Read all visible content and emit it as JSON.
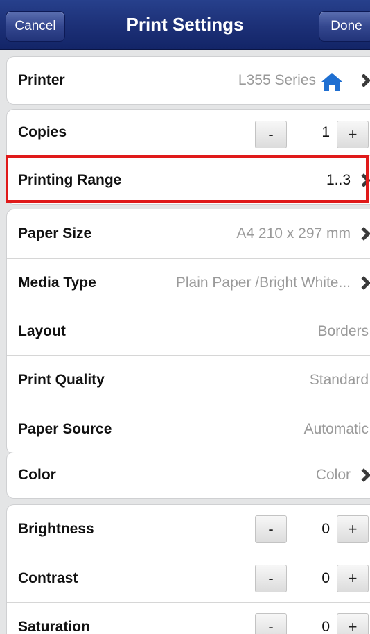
{
  "header": {
    "title": "Print Settings",
    "cancel_label": "Cancel",
    "done_label": "Done"
  },
  "printer": {
    "label": "Printer",
    "value": "L355 Series"
  },
  "copies": {
    "label": "Copies",
    "value": "1",
    "minus": "-",
    "plus": "+"
  },
  "range": {
    "label": "Printing Range",
    "value": "1..3"
  },
  "paper_size": {
    "label": "Paper Size",
    "value": "A4 210 x 297 mm"
  },
  "media_type": {
    "label": "Media Type",
    "value": "Plain Paper /Bright White..."
  },
  "layout": {
    "label": "Layout",
    "value": "Borders"
  },
  "print_quality": {
    "label": "Print Quality",
    "value": "Standard"
  },
  "paper_source": {
    "label": "Paper Source",
    "value": "Automatic"
  },
  "color": {
    "label": "Color",
    "value": "Color"
  },
  "brightness": {
    "label": "Brightness",
    "value": "0",
    "minus": "-",
    "plus": "+"
  },
  "contrast": {
    "label": "Contrast",
    "value": "0",
    "minus": "-",
    "plus": "+"
  },
  "saturation": {
    "label": "Saturation",
    "value": "0",
    "minus": "-",
    "plus": "+"
  },
  "colors": {
    "navbar": "#1d3178",
    "highlight": "#e01a1a",
    "home_icon": "#1f6fd1"
  }
}
